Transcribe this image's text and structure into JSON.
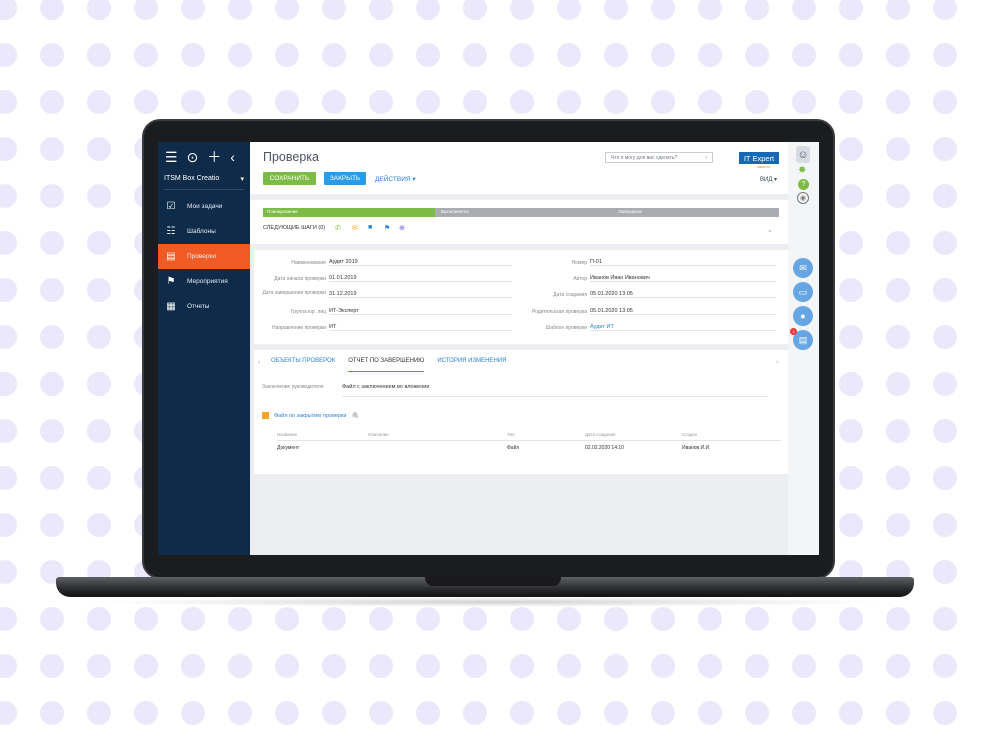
{
  "sidebar": {
    "app_name": "ITSM Box Creatio",
    "items": [
      {
        "label": "Мои задачи",
        "icon": "checkbox-icon"
      },
      {
        "label": "Шаблоны",
        "icon": "list-icon"
      },
      {
        "label": "Проверки",
        "icon": "document-icon",
        "active": true
      },
      {
        "label": "Мероприятия",
        "icon": "flag-icon"
      },
      {
        "label": "Отчеты",
        "icon": "report-icon"
      }
    ]
  },
  "header": {
    "title": "Проверка",
    "save_label": "СОХРАНИТЬ",
    "close_label": "ЗАКРЫТЬ",
    "actions_label": "ДЕЙСТВИЯ ▾",
    "help_placeholder": "Что я могу для вас сделать?",
    "logo_text": "IT Expert",
    "logo_sub": "CREATIO",
    "view_label": "ВИД ▾"
  },
  "stages": {
    "items": [
      "Планирование",
      "Выполняется",
      "Завершена"
    ],
    "next_steps_label": "СЛЕДУЮЩИЕ ШАГИ (0)"
  },
  "fields": {
    "left": [
      {
        "label": "Наименование",
        "value": "Аудит 2019"
      },
      {
        "label": "Дата начала проверки",
        "value": "01.01.2019"
      },
      {
        "label": "Дата завершения проверки",
        "value": "31.12.2019"
      },
      {
        "label": "Группа юр. лиц",
        "value": "ИТ-Эксперт"
      },
      {
        "label": "Направление проверки",
        "value": "ИТ"
      }
    ],
    "right": [
      {
        "label": "Номер",
        "value": "П-01"
      },
      {
        "label": "Автор",
        "value": "Иванов Иван Иванович"
      },
      {
        "label": "Дата создания",
        "value": "05.01.2020  13:05"
      },
      {
        "label": "Родительская проверка",
        "value": "05.01.2020  13:05"
      },
      {
        "label": "Шаблон проверки",
        "value": "Аудит ИТ"
      }
    ]
  },
  "tabs": {
    "items": [
      "ОБЪЕКТЫ ПРОВЕРОК",
      "ОТЧЕТ ПО ЗАВЕРШЕНИЮ",
      "ИСТОРИЯ ИЗМЕНЕНИЯ"
    ],
    "active": "ОТЧЕТ ПО ЗАВЕРШЕНИЮ"
  },
  "report": {
    "conclusion_label": "Заключение руководителя",
    "conclusion_value": "Файл с заключением во вложении",
    "files_title": "Файл по закрытию проверки",
    "columns": [
      "Название",
      "Описание",
      "Тип",
      "Дата создания",
      "Создал"
    ],
    "rows": [
      [
        "Документ",
        "",
        "Файл",
        "02.02.2020  14:10",
        "Иванов И.И."
      ]
    ]
  },
  "right_panel": {
    "notification_badge": "3"
  },
  "colors": {
    "sidebar_bg": "#0e2b4a",
    "active_item": "#f05a24",
    "save_button": "#7cbb45",
    "close_button": "#2b9ce3",
    "link": "#2b83d3"
  }
}
